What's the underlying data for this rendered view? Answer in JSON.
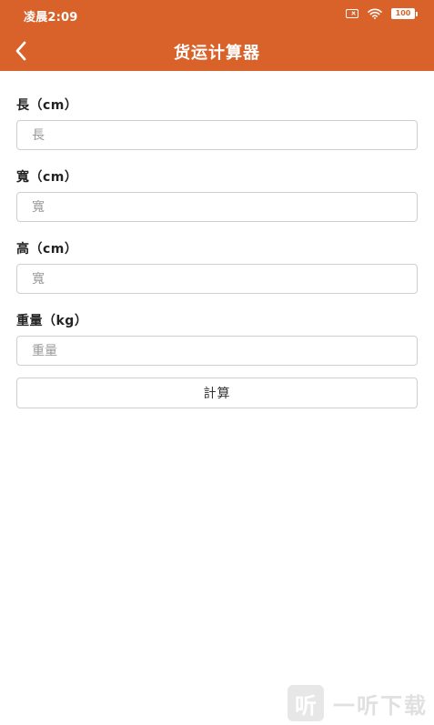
{
  "status_bar": {
    "time": "凌晨2:09",
    "battery": "100",
    "icons": [
      "sim-off-icon",
      "wifi-icon",
      "battery-icon"
    ]
  },
  "header": {
    "title": "货运计算器",
    "back_icon": "chevron-left-icon",
    "background_color": "#d9622b"
  },
  "form": {
    "length": {
      "label": "長（cm）",
      "placeholder": "長",
      "value": ""
    },
    "width": {
      "label": "寬（cm）",
      "placeholder": "寬",
      "value": ""
    },
    "height": {
      "label": "高（cm）",
      "placeholder": "寬",
      "value": ""
    },
    "weight": {
      "label": "重量（kg）",
      "placeholder": "重量",
      "value": ""
    },
    "calculate_label": "計算"
  },
  "watermark": {
    "logo_glyph": "听",
    "text": "一听下载"
  }
}
